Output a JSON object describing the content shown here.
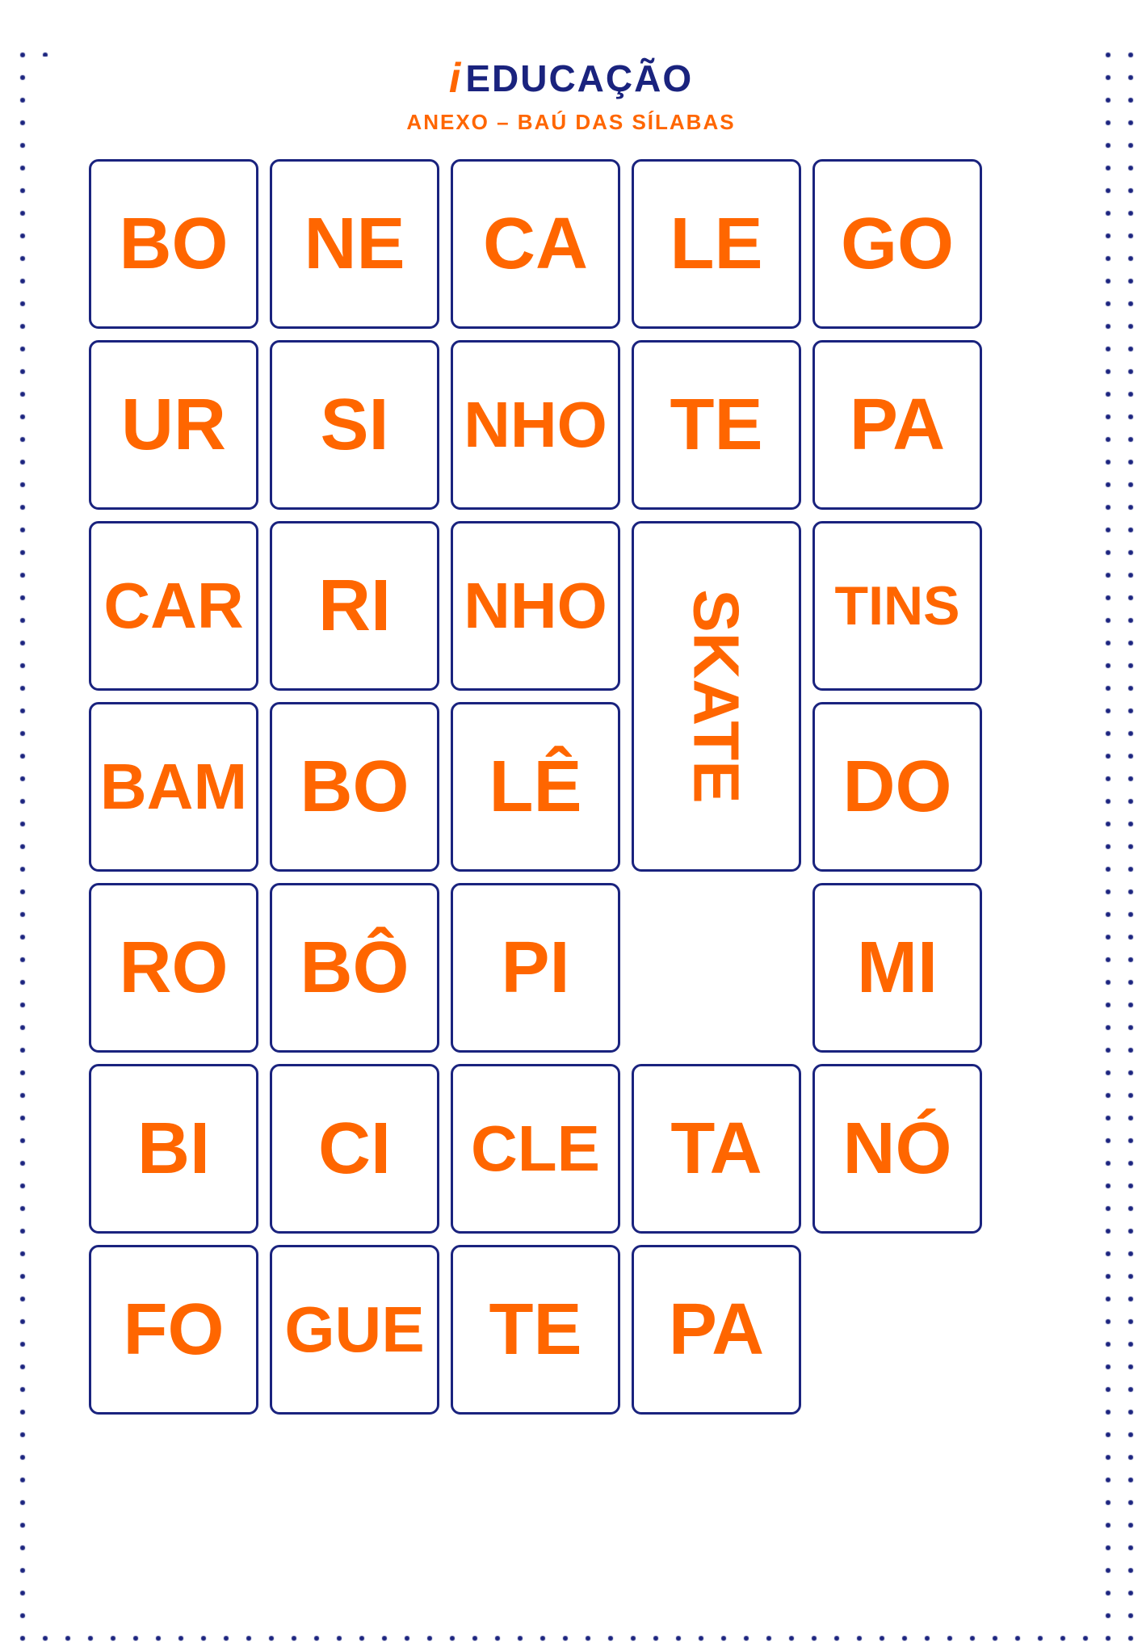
{
  "header": {
    "logo_i": "i",
    "logo_text": "EDUCAÇÃO",
    "subtitle": "ANEXO – BAÚ DAS SÍLABAS"
  },
  "rows": [
    {
      "id": "row1",
      "cards": [
        {
          "id": "bo1",
          "text": "BO",
          "size": "normal"
        },
        {
          "id": "ne",
          "text": "NE",
          "size": "normal"
        },
        {
          "id": "ca",
          "text": "CA",
          "size": "normal"
        },
        {
          "id": "le",
          "text": "LE",
          "size": "normal"
        },
        {
          "id": "go",
          "text": "GO",
          "size": "normal"
        }
      ]
    },
    {
      "id": "row2",
      "cards": [
        {
          "id": "ur",
          "text": "UR",
          "size": "normal"
        },
        {
          "id": "si",
          "text": "SI",
          "size": "normal"
        },
        {
          "id": "nho1",
          "text": "NHO",
          "size": "normal"
        },
        {
          "id": "te1",
          "text": "TE",
          "size": "normal"
        },
        {
          "id": "pa1",
          "text": "PA",
          "size": "normal"
        }
      ]
    },
    {
      "id": "row3",
      "cards": [
        {
          "id": "car",
          "text": "CAR",
          "size": "normal"
        },
        {
          "id": "ri",
          "text": "RI",
          "size": "normal"
        },
        {
          "id": "nho2",
          "text": "NHO",
          "size": "normal"
        },
        {
          "id": "skate",
          "text": "SKATE",
          "size": "skate"
        },
        {
          "id": "tins",
          "text": "TINS",
          "size": "normal"
        }
      ]
    },
    {
      "id": "row4",
      "cards": [
        {
          "id": "bam",
          "text": "BAM",
          "size": "normal"
        },
        {
          "id": "bo2",
          "text": "BO",
          "size": "normal"
        },
        {
          "id": "le2",
          "text": "LÊ",
          "size": "normal"
        },
        {
          "id": "spacer4",
          "text": "",
          "size": "spacer"
        },
        {
          "id": "do",
          "text": "DO",
          "size": "normal"
        }
      ]
    },
    {
      "id": "row5",
      "cards": [
        {
          "id": "ro",
          "text": "RO",
          "size": "normal"
        },
        {
          "id": "bo3",
          "text": "BÔ",
          "size": "normal"
        },
        {
          "id": "pi",
          "text": "PI",
          "size": "normal"
        },
        {
          "id": "spacer5",
          "text": "",
          "size": "spacer"
        },
        {
          "id": "mi",
          "text": "MI",
          "size": "normal"
        }
      ]
    },
    {
      "id": "row6",
      "cards": [
        {
          "id": "bi",
          "text": "BI",
          "size": "normal"
        },
        {
          "id": "ci",
          "text": "CI",
          "size": "normal"
        },
        {
          "id": "cle",
          "text": "CLE",
          "size": "normal"
        },
        {
          "id": "ta",
          "text": "TA",
          "size": "normal"
        },
        {
          "id": "no",
          "text": "NÓ",
          "size": "normal"
        }
      ]
    },
    {
      "id": "row7",
      "cards": [
        {
          "id": "fo",
          "text": "FO",
          "size": "normal"
        },
        {
          "id": "gue",
          "text": "GUE",
          "size": "normal"
        },
        {
          "id": "te2",
          "text": "TE",
          "size": "normal"
        },
        {
          "id": "pa2",
          "text": "PA",
          "size": "normal"
        }
      ]
    }
  ]
}
